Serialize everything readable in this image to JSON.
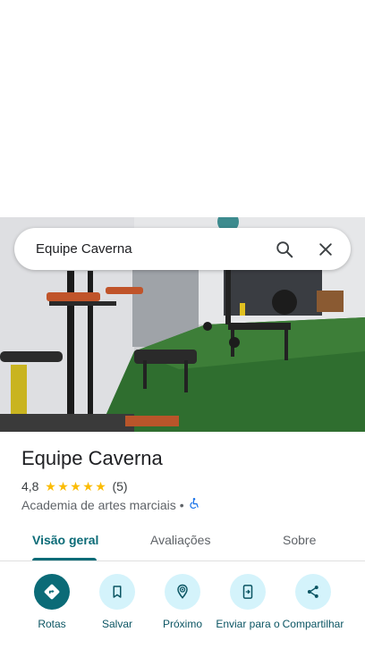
{
  "search": {
    "query": "Equipe Caverna"
  },
  "place": {
    "name": "Equipe Caverna",
    "rating": "4,8",
    "stars": 5,
    "reviews_count": "(5)",
    "category": "Academia de artes marciais",
    "separator": "•"
  },
  "tabs": [
    {
      "label": "Visão geral",
      "active": true
    },
    {
      "label": "Avaliações",
      "active": false
    },
    {
      "label": "Sobre",
      "active": false
    }
  ],
  "actions": [
    {
      "label": "Rotas",
      "icon": "directions-icon"
    },
    {
      "label": "Salvar",
      "icon": "bookmark-icon"
    },
    {
      "label": "Próximo",
      "icon": "nearby-icon"
    },
    {
      "label": "Enviar para o",
      "icon": "send-to-phone-icon"
    },
    {
      "label": "Compartilhar",
      "icon": "share-icon"
    }
  ],
  "colors": {
    "accent": "#0b6b77",
    "action_bg": "#d4f3fb",
    "star": "#fbbc04",
    "accessibility": "#1a73e8"
  }
}
